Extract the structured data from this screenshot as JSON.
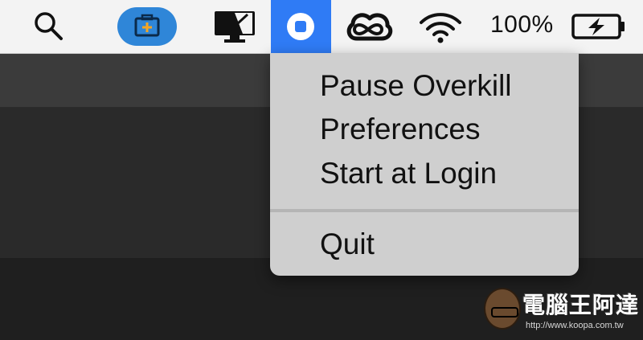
{
  "menubar": {
    "battery_percent": "100%",
    "icons": [
      "search-icon",
      "toolbox-icon",
      "display-icon",
      "overkill-icon",
      "creative-cloud-icon",
      "wifi-icon",
      "battery-charging-icon"
    ]
  },
  "menu": {
    "items": [
      {
        "label": "Pause Overkill"
      },
      {
        "label": "Preferences"
      },
      {
        "label": "Start at Login"
      },
      {
        "label": "Quit"
      }
    ]
  },
  "watermark": {
    "title": "電腦王阿達",
    "url": "http://www.koopa.com.tw"
  },
  "colors": {
    "menubar_bg": "#f3f3f3",
    "active_item": "#2f7bf5",
    "menu_bg": "#cfcfcf",
    "toolbox_bg": "#2f86d8"
  }
}
